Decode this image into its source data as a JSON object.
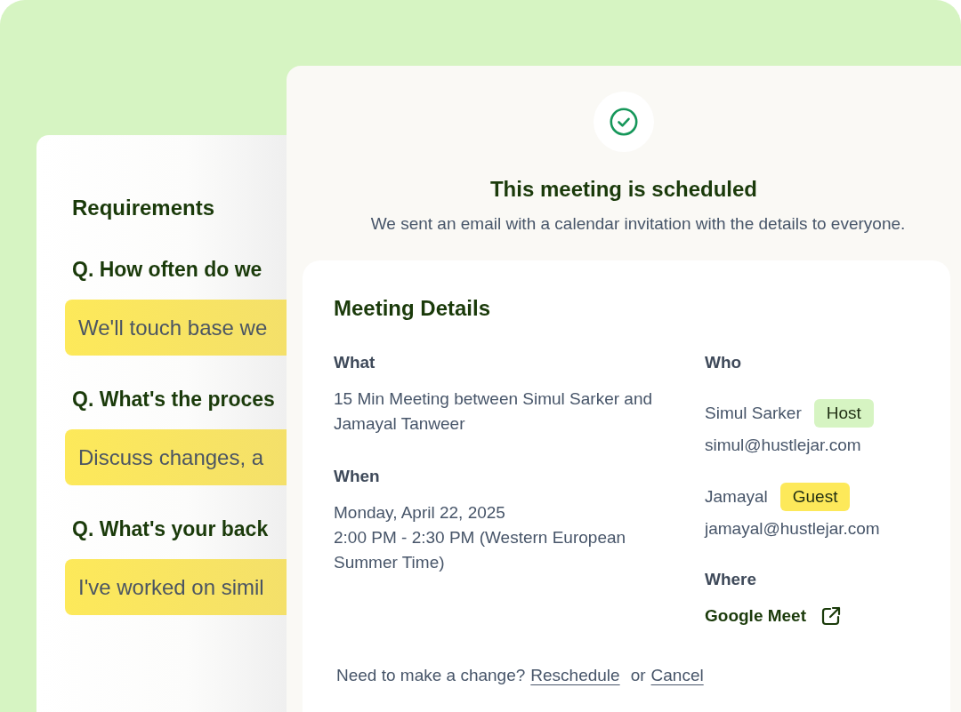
{
  "requirements": {
    "title": "Requirements",
    "items": [
      {
        "question": "Q. How often do we",
        "answer": "We'll touch base we"
      },
      {
        "question": "Q. What's the proces",
        "answer": "Discuss changes, a"
      },
      {
        "question": "Q. What's your back",
        "answer": "I've worked on simil"
      }
    ]
  },
  "confirmation": {
    "title": "This meeting is scheduled",
    "subtitle": "We sent an email with a calendar invitation with the details to everyone."
  },
  "details": {
    "title": "Meeting Details",
    "what": {
      "label": "What",
      "text": "15 Min Meeting between Simul Sarker and Jamayal Tanweer"
    },
    "when": {
      "label": "When",
      "date": "Monday, April 22, 2025",
      "time": "2:00 PM - 2:30 PM (Western European Summer Time)"
    },
    "who": {
      "label": "Who",
      "people": [
        {
          "name": "Simul Sarker",
          "role": "Host",
          "kind": "host",
          "email": "simul@hustlejar.com"
        },
        {
          "name": "Jamayal",
          "role": "Guest",
          "kind": "guest",
          "email": "jamayal@hustlejar.com"
        }
      ]
    },
    "where": {
      "label": "Where",
      "link": "Google Meet"
    },
    "footer": {
      "prompt": "Need to make a change?",
      "reschedule": "Reschedule",
      "or": "or",
      "cancel": "Cancel"
    }
  }
}
